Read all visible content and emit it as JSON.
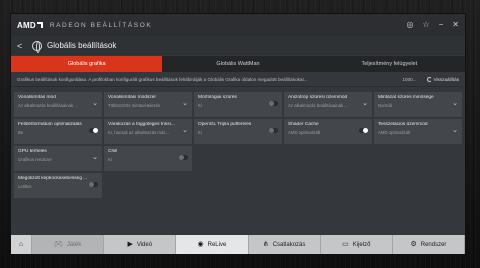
{
  "app": {
    "logo": "AMD",
    "title": "RADEON BEÁLLÍTÁSOK"
  },
  "nav": {
    "back": "<",
    "page_title": "Globális beállítások"
  },
  "titlebar_icons": [
    "target-icon",
    "star-icon",
    "minimize-icon",
    "close-icon"
  ],
  "tabs": [
    {
      "label": "Globális grafika",
      "active": true
    },
    {
      "label": "Globális WattMan",
      "active": false
    },
    {
      "label": "Teljesítmény felügyelet",
      "active": false
    }
  ],
  "info": {
    "text": "Grafikus beállítások konfigurálása. A profilokban konfigurált grafikus beállítások felülbírálják a Globális Grafika oldalon megadott beállításokat...",
    "more": "1000...",
    "reset": "Visszaállítás"
  },
  "settings": [
    {
      "name": "Vonalsimítás mód",
      "value": "Az alkalmazás beállításainak ...",
      "control": "dropdown"
    },
    {
      "name": "Vonalsimítási módszer",
      "value": "Többszörös mintavételezés",
      "control": "dropdown"
    },
    {
      "name": "Morfológiai szűrés",
      "value": "Ki",
      "control": "toggle",
      "on": false
    },
    {
      "name": "Anizotróp szűrési üzemmód",
      "value": "Az alkalmazás beállításainak ...",
      "control": "dropdown"
    },
    {
      "name": "Mintázat szűrés minősége",
      "value": "Normál",
      "control": "dropdown"
    },
    {
      "name": "Felületformátum optimalizálás",
      "value": "Be",
      "control": "toggle",
      "on": true
    },
    {
      "name": "Várakozás a függőleges frissí...",
      "value": "Ki, hacsak az alkalmazás más...",
      "control": "dropdown"
    },
    {
      "name": "OpenGL Tripla pufferelés",
      "value": "Ki",
      "control": "toggle",
      "on": false
    },
    {
      "name": "Shader Cache",
      "value": "AMD optimalizált",
      "control": "toggle",
      "on": true
    },
    {
      "name": "Tesszelációs üzemmód",
      "value": "AMD optimalizált",
      "control": "dropdown"
    },
    {
      "name": "GPU terhelés",
      "value": "Grafikus rendszer",
      "control": "dropdown"
    },
    {
      "name": "Chill",
      "value": "Ki",
      "control": "toggle",
      "on": false
    },
    {
      "name": "Megolizott képkockasebesség ...",
      "value": "Letiltve",
      "control": "toggle",
      "on": false
    }
  ],
  "bottom_nav": [
    {
      "label": "",
      "icon": "home-icon",
      "state": "home"
    },
    {
      "label": "Játék",
      "icon": "gamepad-icon",
      "state": "dim"
    },
    {
      "label": "Videó",
      "icon": "play-icon",
      "state": ""
    },
    {
      "label": "ReLive",
      "icon": "relive-icon",
      "state": ""
    },
    {
      "label": "Csatlakozás",
      "icon": "share-icon",
      "state": ""
    },
    {
      "label": "Kijelző",
      "icon": "monitor-icon",
      "state": ""
    },
    {
      "label": "Rendszer",
      "icon": "gear-icon",
      "state": ""
    }
  ]
}
